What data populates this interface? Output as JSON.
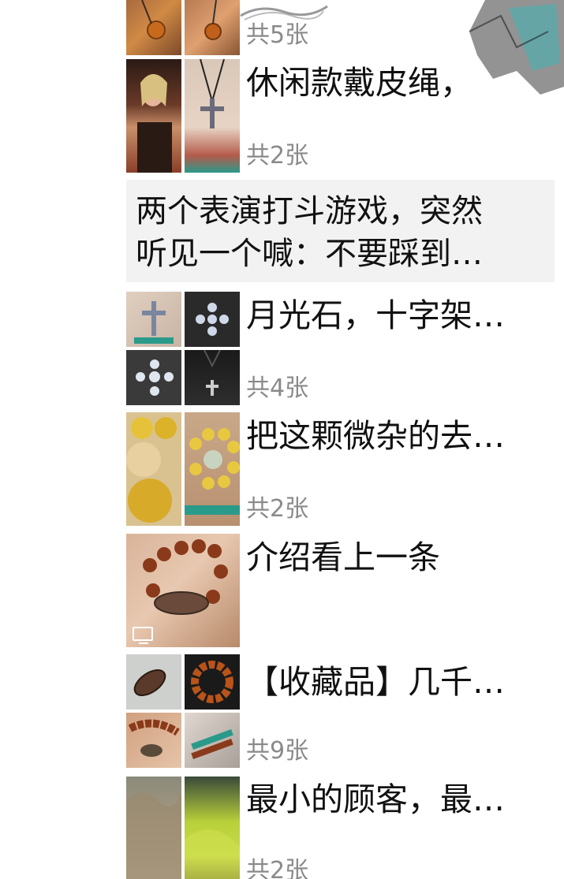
{
  "timeline": {
    "posts": [
      {
        "caption": "",
        "count": "共5张",
        "images": [
          "amber-pendant-photo",
          "amber-pendant-photo"
        ]
      },
      {
        "caption": "休闲款戴皮绳，",
        "count": "共2张",
        "images": [
          "woman-wearing-pendant-photo",
          "cross-pendant-in-hand-photo"
        ]
      },
      {
        "caption": "两个表演打斗游戏，突然听见一个喊：不要踩到…",
        "line1": "两个表演打斗游戏，突然",
        "line2": "听见一个喊：不要踩到…",
        "count": ""
      },
      {
        "caption": "月光石，十字架…",
        "count": "共4张",
        "images": [
          "moonstone-cross-in-hand-photo",
          "moonstone-cross-photo",
          "moonstone-cross-closeup-photo",
          "cross-on-shirt-photo"
        ]
      },
      {
        "caption": "把这颗微杂的去…",
        "count": "共2张",
        "images": [
          "yellow-beads-closeup-photo",
          "yellow-bead-bracelet-photo"
        ]
      },
      {
        "caption": "介绍看上一条",
        "count": "",
        "images": [
          "dzi-bead-bracelet-video"
        ]
      },
      {
        "caption": "【收藏品】几千…",
        "count": "共9张",
        "images": [
          "dzi-bead-photo",
          "amber-bracelet-photo",
          "bracelet-in-hand-photo",
          "bracelet-on-wrist-photo"
        ]
      },
      {
        "caption": "最小的顾客，最…",
        "count": "共2张",
        "images": [
          "child-photo",
          "child-photo"
        ]
      }
    ]
  },
  "colors": {
    "caption_text": "#111111",
    "count_text": "#8a8a8a",
    "text_post_bg": "#f2f2f2"
  }
}
